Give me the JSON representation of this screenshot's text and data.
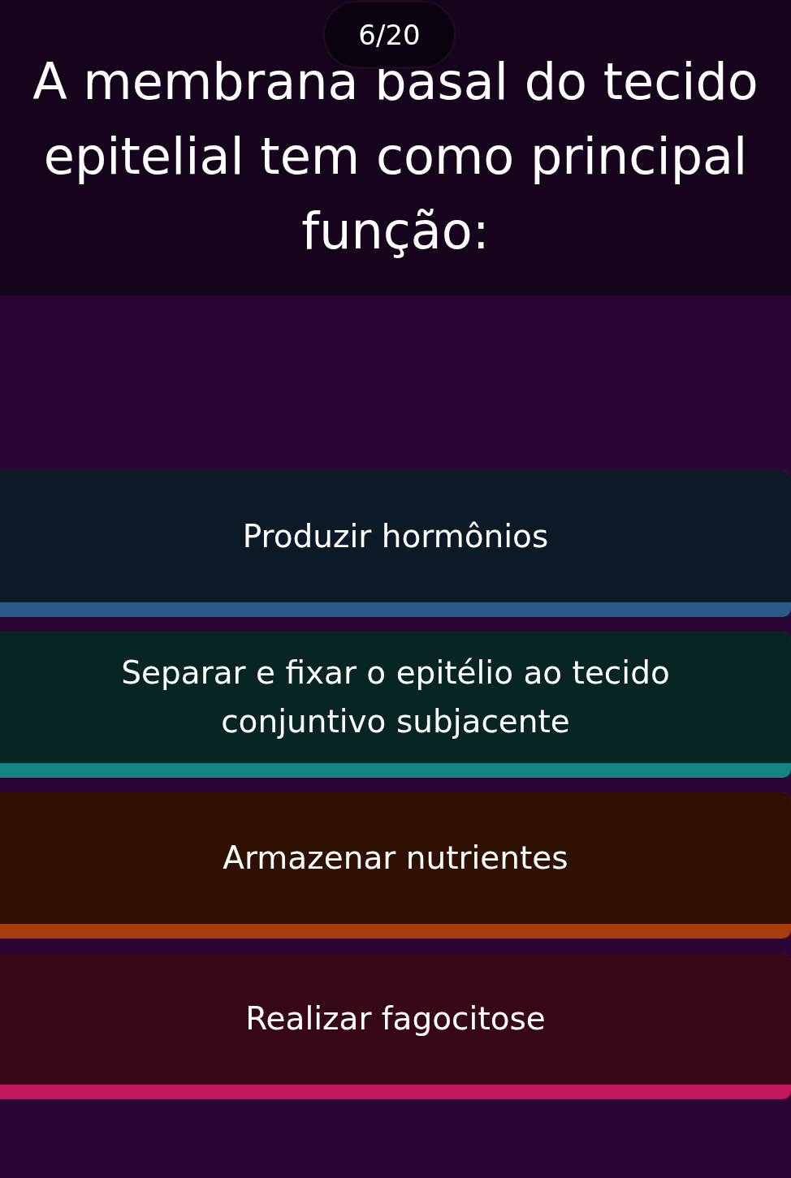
{
  "counter": "6/20",
  "question": "A membrana basal do tecido epitelial tem como principal função:",
  "answers": [
    {
      "text": "Produzir hormônios",
      "color": "#2a5a8c"
    },
    {
      "text": "Separar e fixar o epitélio ao tecido conjuntivo subjacente",
      "color": "#16857f"
    },
    {
      "text": "Armazenar nutrientes",
      "color": "#a83c0a"
    },
    {
      "text": "Realizar fagocitose",
      "color": "#c2185b"
    }
  ]
}
